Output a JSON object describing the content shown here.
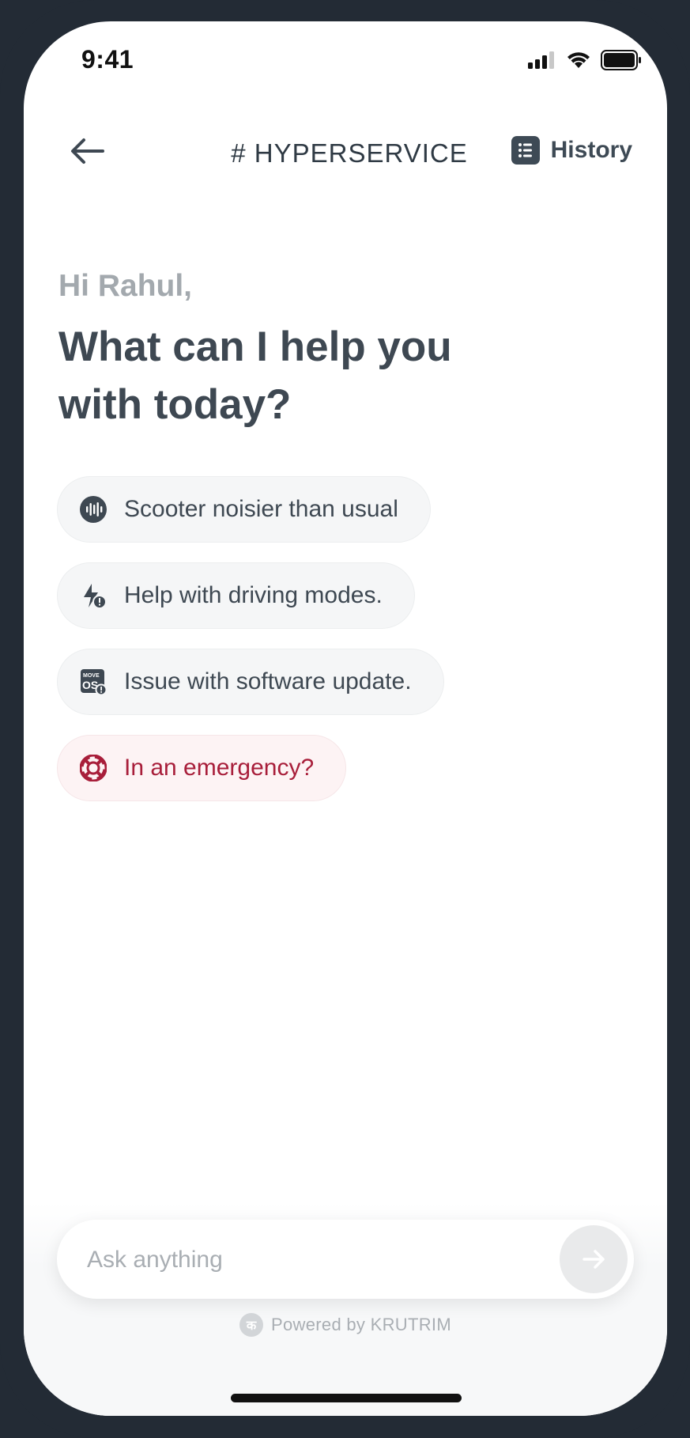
{
  "status_bar": {
    "time": "9:41"
  },
  "header": {
    "title": "# HYPERSERVICE",
    "history_label": "History"
  },
  "greeting": {
    "hello": "Hi Rahul,",
    "question": "What can I help you with today?"
  },
  "suggestions": [
    {
      "label": "Scooter noisier than usual",
      "icon": "sound-wave-icon"
    },
    {
      "label": "Help with driving modes.",
      "icon": "bolt-alert-icon"
    },
    {
      "label": "Issue with software update.",
      "icon": "moveos-update-icon"
    },
    {
      "label": "In an emergency?",
      "icon": "lifebuoy-icon"
    }
  ],
  "input": {
    "placeholder": "Ask anything"
  },
  "footer": {
    "powered_by": "Powered by KRUTRIM"
  },
  "colors": {
    "text_primary": "#3e4852",
    "text_muted": "#a3a9ae",
    "emergency": "#a81e3a",
    "chip_bg": "#f5f6f7",
    "frame": "#232b35"
  }
}
